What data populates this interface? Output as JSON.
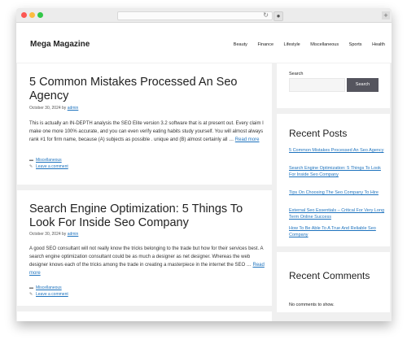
{
  "site": {
    "title": "Mega Magazine",
    "nav": [
      "Beauty",
      "Finance",
      "Lifestyle",
      "Miscellaneous",
      "Sports",
      "Health"
    ]
  },
  "posts": [
    {
      "title": "5 Common Mistakes Processed An Seo Agency",
      "date": "October 30, 2024",
      "by": "by",
      "author": "admin",
      "excerpt": "This is actually an IN-DEPTH analysis the SEO Elite version 3.2 software that is at present out. Every claim I make one more 100% accurate, and you can even verify eating habits study yourself. You will almost always rank #1 for firm name, because (A) subjects as possible . unique and (B) almost certainly all …",
      "read_more": "Read more",
      "category": "Miscellaneous",
      "comment_link": "Leave a comment"
    },
    {
      "title": "Search Engine Optimization: 5 Things To Look For Inside Seo Company",
      "date": "October 30, 2024",
      "by": "by",
      "author": "admin",
      "excerpt": "A good SEO consultant will not really know the tricks belonging to the trade but how for their services best. A search engine optimization consultant could be as much a designer as net designer. Whereas the web designer knows each of the tricks among the trade in creating a masterpiece in the internet the SEO …",
      "read_more": "Read more",
      "category": "Miscellaneous",
      "comment_link": "Leave a comment"
    }
  ],
  "sidebar": {
    "search_label": "Search",
    "search_button": "Search",
    "recent_posts_title": "Recent Posts",
    "recent_posts": [
      "5 Common Mistakes Processed An Seo Agency",
      "Search Engine Optimization: 5 Things To Look For Inside Seo Company",
      "Tips On Choosing The Seo Company To Hire",
      "External Seo Essentials – Critical For Very Long Term Online Success",
      "How To Be Able To A True And Reliable Seo Company"
    ],
    "recent_comments_title": "Recent Comments",
    "no_comments": "No comments to show."
  },
  "colors": {
    "link": "#1e73be",
    "search_button_bg": "#55555e",
    "page_bg": "#f0f0f0"
  }
}
